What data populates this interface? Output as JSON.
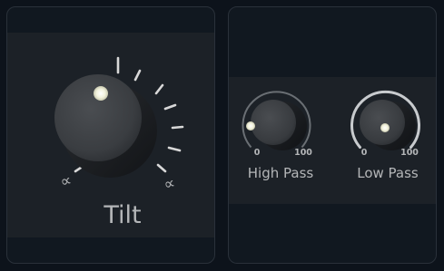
{
  "tilt": {
    "label": "Tilt",
    "left_symbol": "∝",
    "right_symbol": "∝"
  },
  "high_pass": {
    "label": "High Pass",
    "min_label": "0",
    "max_label": "100",
    "value": 0
  },
  "low_pass": {
    "label": "Low Pass",
    "min_label": "0",
    "max_label": "100",
    "value": 100
  },
  "colors": {
    "background": "#0d131b",
    "panel": "#111820",
    "band": "#1c2127",
    "knob": "#3c3f43",
    "indicator": "#f2f2dc",
    "label": "#b4b6b8"
  }
}
